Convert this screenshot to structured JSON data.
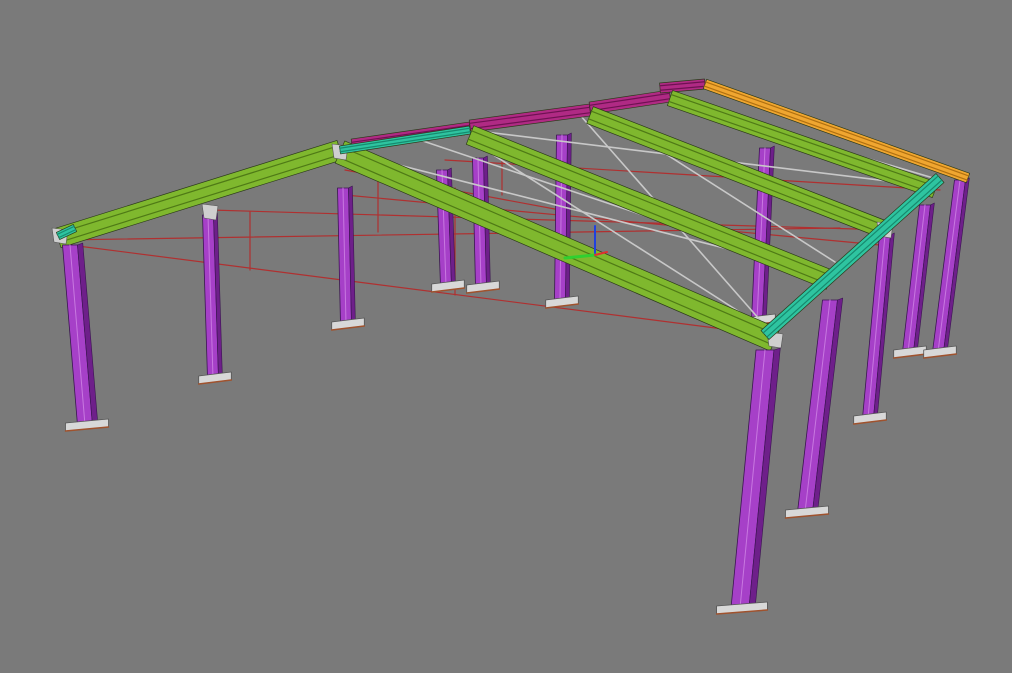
{
  "viewport": {
    "background": "#7a7a7a",
    "view": "3d-perspective"
  },
  "model": {
    "type": "steel-portal-frame-building",
    "bays": 4,
    "roof": "gable",
    "colors": {
      "columns": "#a640c8",
      "column_dark": "#6e1f8a",
      "rafters": "#7fb82e",
      "rafter_dark": "#4f7a16",
      "eave_beams": "#2ec4a0",
      "eave_dark": "#178a6e",
      "ridge_purlin": "#b02a84",
      "ridge_dark": "#6e1252",
      "end_purlin": "#f0a630",
      "bracing_rods": "#c8c8c8",
      "floor_ties": "#b03030",
      "base_plates": "#d8d8d8",
      "haunch_plates": "#cfcfcf"
    }
  },
  "axes_gizmo": {
    "x_color": "#e03030",
    "y_color": "#30d030",
    "z_color": "#2040e0"
  }
}
